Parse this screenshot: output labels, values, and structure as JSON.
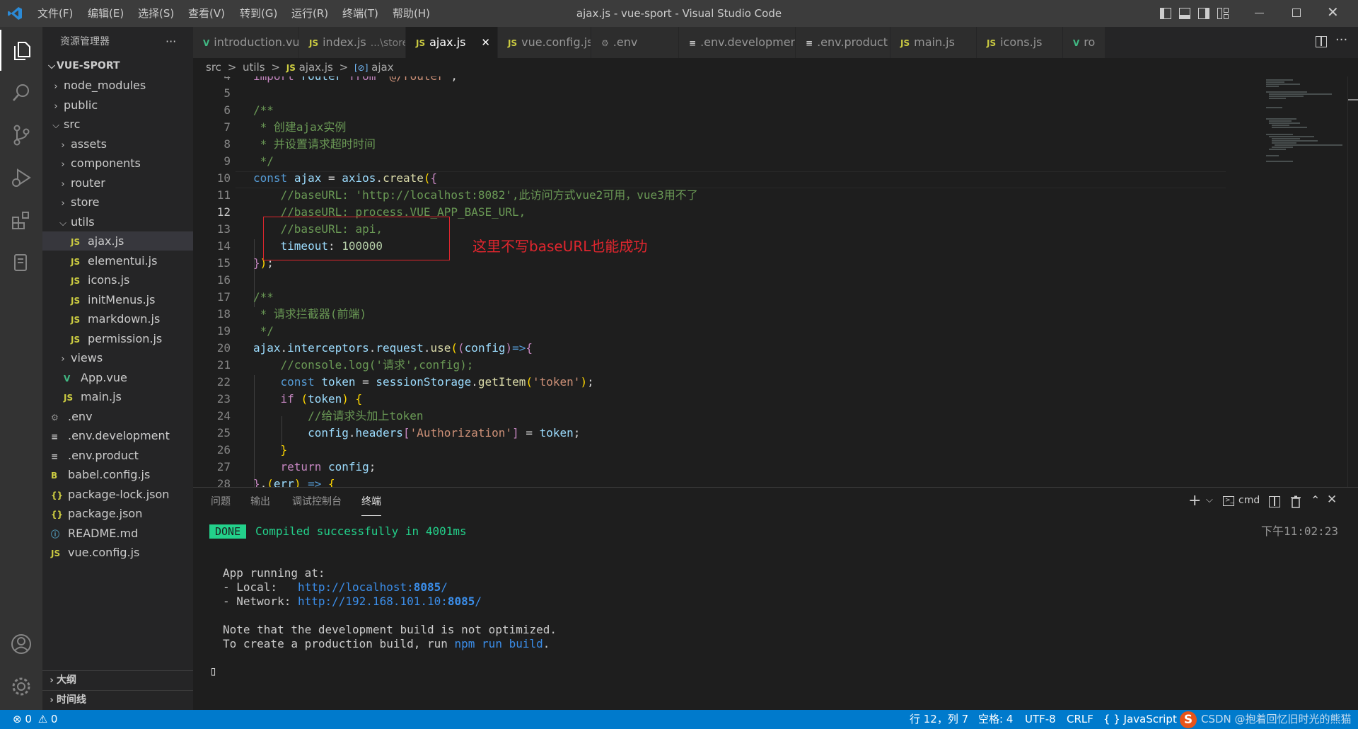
{
  "window": {
    "title": "ajax.js - vue-sport - Visual Studio Code"
  },
  "menu": [
    "文件(F)",
    "编辑(E)",
    "选择(S)",
    "查看(V)",
    "转到(G)",
    "运行(R)",
    "终端(T)",
    "帮助(H)"
  ],
  "sidebar": {
    "header": "资源管理器",
    "more": "···",
    "project": "VUE-SPORT",
    "tree": [
      {
        "label": "node_modules",
        "type": "folder",
        "depth": 1,
        "open": false,
        "icon": ""
      },
      {
        "label": "public",
        "type": "folder",
        "depth": 1,
        "open": false,
        "icon": ""
      },
      {
        "label": "src",
        "type": "folder",
        "depth": 1,
        "open": true,
        "icon": ""
      },
      {
        "label": "assets",
        "type": "folder",
        "depth": 2,
        "open": false,
        "icon": ""
      },
      {
        "label": "components",
        "type": "folder",
        "depth": 2,
        "open": false,
        "icon": ""
      },
      {
        "label": "router",
        "type": "folder",
        "depth": 2,
        "open": false,
        "icon": ""
      },
      {
        "label": "store",
        "type": "folder",
        "depth": 2,
        "open": false,
        "icon": ""
      },
      {
        "label": "utils",
        "type": "folder",
        "depth": 2,
        "open": true,
        "icon": ""
      },
      {
        "label": "ajax.js",
        "type": "file",
        "depth": 3,
        "icon": "JS",
        "selected": true
      },
      {
        "label": "elementui.js",
        "type": "file",
        "depth": 3,
        "icon": "JS"
      },
      {
        "label": "icons.js",
        "type": "file",
        "depth": 3,
        "icon": "JS"
      },
      {
        "label": "initMenus.js",
        "type": "file",
        "depth": 3,
        "icon": "JS"
      },
      {
        "label": "markdown.js",
        "type": "file",
        "depth": 3,
        "icon": "JS"
      },
      {
        "label": "permission.js",
        "type": "file",
        "depth": 3,
        "icon": "JS"
      },
      {
        "label": "views",
        "type": "folder",
        "depth": 2,
        "open": false,
        "icon": ""
      },
      {
        "label": "App.vue",
        "type": "file",
        "depth": 2,
        "icon": "V"
      },
      {
        "label": "main.js",
        "type": "file",
        "depth": 2,
        "icon": "JS"
      },
      {
        "label": ".env",
        "type": "file",
        "depth": 1,
        "icon": "⚙"
      },
      {
        "label": ".env.development",
        "type": "file",
        "depth": 1,
        "icon": "≡"
      },
      {
        "label": ".env.product",
        "type": "file",
        "depth": 1,
        "icon": "≡"
      },
      {
        "label": "babel.config.js",
        "type": "file",
        "depth": 1,
        "icon": "B"
      },
      {
        "label": "package-lock.json",
        "type": "file",
        "depth": 1,
        "icon": "{}"
      },
      {
        "label": "package.json",
        "type": "file",
        "depth": 1,
        "icon": "{}"
      },
      {
        "label": "README.md",
        "type": "file",
        "depth": 1,
        "icon": "ⓘ"
      },
      {
        "label": "vue.config.js",
        "type": "file",
        "depth": 1,
        "icon": "JS"
      }
    ],
    "outline": "大纲",
    "timeline": "时间线"
  },
  "tabs": [
    {
      "label": "introduction.vue",
      "icon": "V",
      "hint": ""
    },
    {
      "label": "index.js",
      "icon": "JS",
      "hint": "...\\store"
    },
    {
      "label": "ajax.js",
      "icon": "JS",
      "hint": "",
      "active": true,
      "close": "✕"
    },
    {
      "label": "vue.config.js",
      "icon": "JS",
      "hint": ""
    },
    {
      "label": ".env",
      "icon": "⚙",
      "hint": ""
    },
    {
      "label": ".env.development",
      "icon": "≡",
      "hint": ""
    },
    {
      "label": ".env.product",
      "icon": "≡",
      "hint": ""
    },
    {
      "label": "main.js",
      "icon": "JS",
      "hint": ""
    },
    {
      "label": "icons.js",
      "icon": "JS",
      "hint": ""
    },
    {
      "label": "ro",
      "icon": "V",
      "hint": ""
    }
  ],
  "breadcrumb": {
    "part1": "src",
    "part2": "utils",
    "part3_icon": "JS",
    "part3": "ajax.js",
    "part4_icon": "[⊘]",
    "part4": "ajax",
    "sep": ">"
  },
  "editor": {
    "line_numbers": [
      "4",
      "5",
      "6",
      "7",
      "8",
      "9",
      "10",
      "11",
      "12",
      "13",
      "14",
      "15",
      "16",
      "17",
      "18",
      "19",
      "20",
      "21",
      "22",
      "23",
      "24",
      "25",
      "26",
      "27",
      "28"
    ],
    "current_line": "12",
    "annotation": "这里不写baseURL也能成功"
  },
  "panel": {
    "tabs": [
      "问题",
      "输出",
      "调试控制台",
      "终端"
    ],
    "active_tab": "终端",
    "shell": "cmd",
    "done_badge": "DONE",
    "compiled": "Compiled successfully in 4001ms",
    "time": "下午11:02:23",
    "app_running": "App running at:",
    "local_label": "- Local:   ",
    "local_url_a": "http://localhost:",
    "local_port": "8085",
    "url_slash": "/",
    "network_label": "- Network: ",
    "network_url_a": "http://192.168.101.10:",
    "network_port": "8085",
    "note1": "Note that the development build is not optimized.",
    "note2_a": "To create a production build, run ",
    "note2_cmd": "npm run build",
    "note2_b": ".",
    "cursor": "▯"
  },
  "status": {
    "errors": "0",
    "warnings": "0",
    "position": "行 12，列 7",
    "spaces": "空格: 4",
    "encoding": "UTF-8",
    "eol": "CRLF",
    "language": "JavaScript",
    "watermark": "CSDN @抱着回忆旧时光的熊猫"
  },
  "colors": {
    "accent": "#007acc",
    "title_bar": "#3c3c3c",
    "activity": "#333333",
    "sidebar": "#252526",
    "editor": "#1e1e1e",
    "annotation": "#e0262e",
    "done": "#23d18b"
  }
}
